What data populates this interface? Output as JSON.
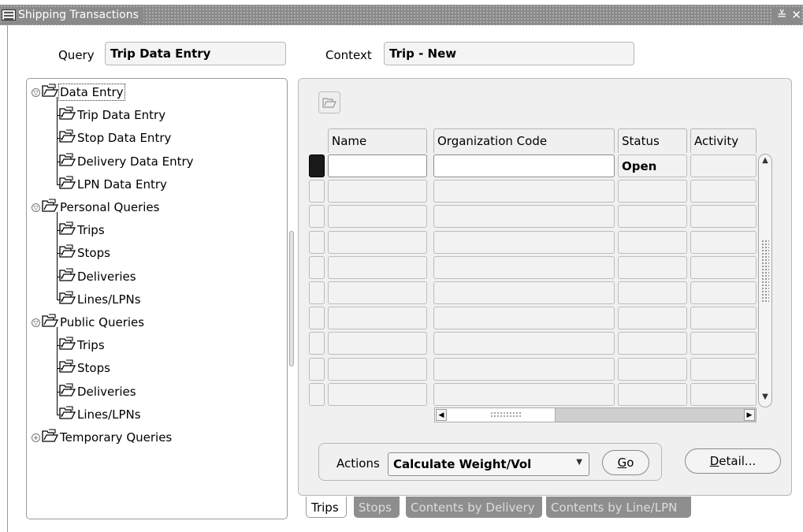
{
  "window": {
    "title": "Shipping Transactions",
    "controls": [
      "≚",
      "✕"
    ]
  },
  "header": {
    "query_label": "Query",
    "query_value": "Trip Data Entry",
    "context_label": "Context",
    "context_value": "Trip - New"
  },
  "tree": {
    "items": [
      {
        "label": "Data Entry",
        "level": 0,
        "expander": "open",
        "focused": true
      },
      {
        "label": "Trip Data Entry",
        "level": 1
      },
      {
        "label": "Stop Data Entry",
        "level": 1
      },
      {
        "label": "Delivery Data Entry",
        "level": 1
      },
      {
        "label": "LPN Data Entry",
        "level": 1
      },
      {
        "label": "Personal Queries",
        "level": 0,
        "expander": "open"
      },
      {
        "label": "Trips",
        "level": 1
      },
      {
        "label": "Stops",
        "level": 1
      },
      {
        "label": "Deliveries",
        "level": 1
      },
      {
        "label": "Lines/LPNs",
        "level": 1
      },
      {
        "label": "Public Queries",
        "level": 0,
        "expander": "open"
      },
      {
        "label": "Trips",
        "level": 1
      },
      {
        "label": "Stops",
        "level": 1
      },
      {
        "label": "Deliveries",
        "level": 1
      },
      {
        "label": "Lines/LPNs",
        "level": 1
      },
      {
        "label": "Temporary Queries",
        "level": 0,
        "expander": "closed"
      }
    ]
  },
  "grid": {
    "columns": [
      "Name",
      "Organization Code",
      "Status",
      "Activity"
    ],
    "rows": [
      [
        "",
        "",
        "Open",
        ""
      ],
      [
        "",
        "",
        "",
        ""
      ],
      [
        "",
        "",
        "",
        ""
      ],
      [
        "",
        "",
        "",
        ""
      ],
      [
        "",
        "",
        "",
        ""
      ],
      [
        "",
        "",
        "",
        ""
      ],
      [
        "",
        "",
        "",
        ""
      ],
      [
        "",
        "",
        "",
        ""
      ],
      [
        "",
        "",
        "",
        ""
      ],
      [
        "",
        "",
        "",
        ""
      ]
    ]
  },
  "actions": {
    "label": "Actions",
    "selected": "Calculate Weight/Vol",
    "go_mnemonic": "G",
    "go_rest": "o",
    "detail_mnemonic": "D",
    "detail_rest": "etail..."
  },
  "tabs": [
    {
      "label": "Trips",
      "active": true
    },
    {
      "label": "Stops",
      "active": false
    },
    {
      "label": "Contents by Delivery",
      "active": false
    },
    {
      "label": "Contents by Line/LPN",
      "active": false
    }
  ],
  "colors": {
    "titlebar": "#8a8a8a",
    "panel": "#f0f0f0",
    "inactive_tab": "#8e8e8e"
  }
}
